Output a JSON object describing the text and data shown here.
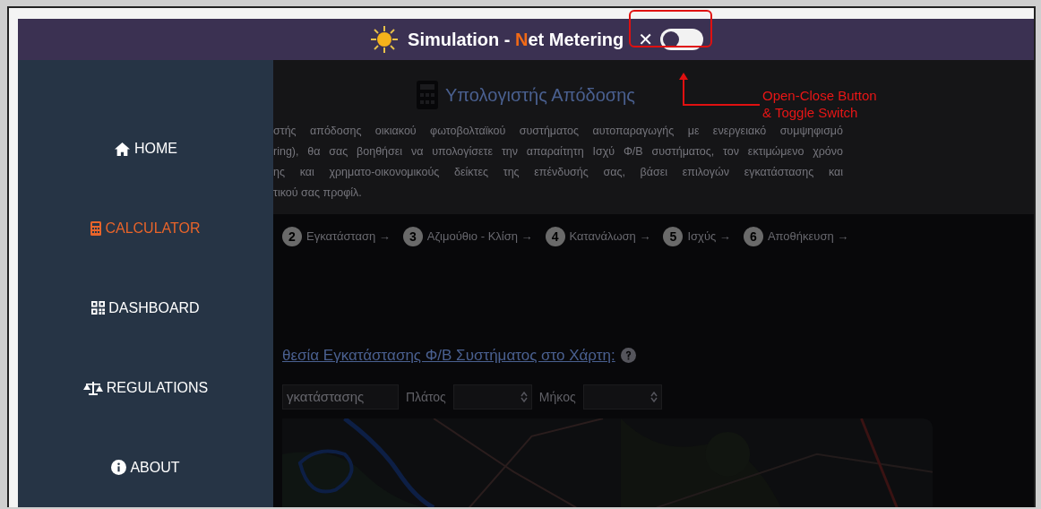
{
  "header": {
    "title_prefix": "Simulation - ",
    "title_accent": "N",
    "title_rest": "et Metering",
    "close_glyph": "✕",
    "toggle": {
      "on": false
    }
  },
  "annotation": {
    "text_lines": [
      "Open-Close Button",
      "& Toggle Switch"
    ]
  },
  "sidebar": {
    "items": [
      {
        "label": "HOME",
        "kind": "home",
        "selected": false
      },
      {
        "label": "CALCULATOR",
        "kind": "calculator",
        "selected": true
      },
      {
        "label": "DASHBOARD",
        "kind": "grid",
        "selected": false
      },
      {
        "label": "REGULATIONS",
        "kind": "scales",
        "selected": false
      },
      {
        "label": "ABOUT",
        "kind": "info",
        "selected": false
      }
    ]
  },
  "intro": {
    "heading": "Υπολογιστής Απόδοσης",
    "lines": [
      "στής απόδοσης οικιακού φωτοβολταϊκού συστήματος αυτοπαραγωγής με ενεργειακό συμψηφισμό",
      "ring), θα σας βοηθήσει να υπολογίσετε την απαραίτητη Ισχύ Φ/Β συστήματος, τον εκτιμώμενο χρόνο",
      "ης και χρηματο-οικονομικούς δείκτες της επένδυσής σας, βάσει επιλογών εγκατάστασης και",
      "τικού σας προφίλ."
    ]
  },
  "steps": [
    {
      "number": "2",
      "label": "Εγκατάσταση",
      "arrow": "→"
    },
    {
      "number": "3",
      "label": "Αζιμούθιο - Κλίση",
      "arrow": "→"
    },
    {
      "number": "4",
      "label": "Κατανάλωση",
      "arrow": "→"
    },
    {
      "number": "5",
      "label": "Ισχύς",
      "arrow": "→"
    },
    {
      "number": "6",
      "label": "Αποθήκευση",
      "arrow": "→"
    }
  ],
  "location": {
    "link": "θεσία Εγκατάστασης Φ/Β Συστήματος στο Χάρτη:",
    "address_value": "γκατάστασης",
    "lat_label": "Πλάτος",
    "lon_label": "Μήκος"
  }
}
